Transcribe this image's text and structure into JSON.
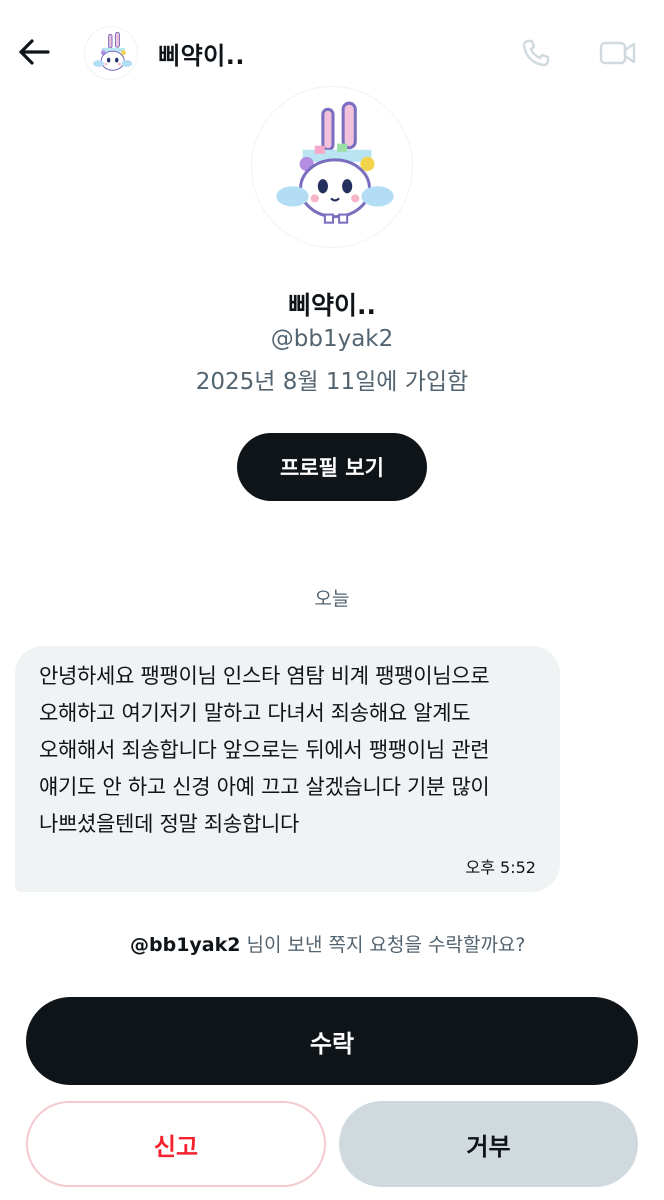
{
  "header": {
    "name": "삐약이..",
    "back_icon": "arrow-left-icon",
    "call_icon": "phone-icon",
    "video_icon": "video-camera-icon"
  },
  "profile": {
    "name": "삐약이..",
    "handle": "@bb1yak2",
    "joined": "2025년 8월 11일에 가입함",
    "view_profile_label": "프로필 보기",
    "avatar_icon": "bunny-avatar-icon"
  },
  "conversation": {
    "day_label": "오늘",
    "messages": [
      {
        "text": "안녕하세요 팽팽이님 인스타 염탐 비계 팽팽이님으로 오해하고 여기저기 말하고 다녀서 죄송해요 알계도 오해해서 죄송합니다 앞으로는 뒤에서 팽팽이님 관련 얘기도 안 하고 신경 아예 끄고 살겠습니다 기분 많이 나쁘셨을텐데 정말 죄송합니다",
        "time": "오후 5:52"
      }
    ]
  },
  "request": {
    "handle": "@bb1yak2",
    "prompt": " 님이 보낸 쪽지 요청을 수락할까요?",
    "accept_label": "수락",
    "report_label": "신고",
    "decline_label": "거부"
  },
  "colors": {
    "primary_text": "#0f1419",
    "secondary_text": "#536471",
    "bubble_bg": "#eff3f4",
    "danger": "#f4212e",
    "decline_bg": "#cfd9de"
  }
}
